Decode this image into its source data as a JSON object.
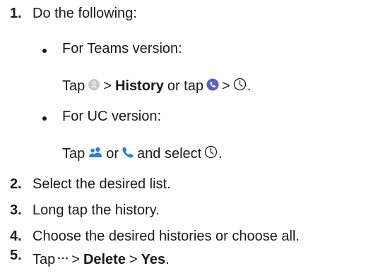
{
  "steps": {
    "s1": {
      "num": "1.",
      "text": "Do the following:"
    },
    "s2": {
      "num": "2.",
      "text": "Select the desired list."
    },
    "s3": {
      "num": "3.",
      "text": "Long tap the history."
    },
    "s4": {
      "num": "4.",
      "text": "Choose the desired histories or choose all."
    },
    "s5": {
      "num": "5.",
      "tap": "Tap",
      "gt1": ">",
      "delete": "Delete",
      "gt2": ">",
      "yes": "Yes",
      "end": "."
    }
  },
  "teams": {
    "heading": "For Teams version:",
    "tap": "Tap",
    "gt1": ">",
    "history": "History",
    "or_tap": "or tap",
    "gt2": ">",
    "end": "."
  },
  "uc": {
    "heading": "For UC version:",
    "tap": "Tap",
    "or": "or",
    "and_select": "and select",
    "end": "."
  },
  "colors": {
    "accent_blue": "#2a7de1",
    "icon_purple": "#5b5fc7",
    "icon_gray": "#c8c8c8"
  }
}
